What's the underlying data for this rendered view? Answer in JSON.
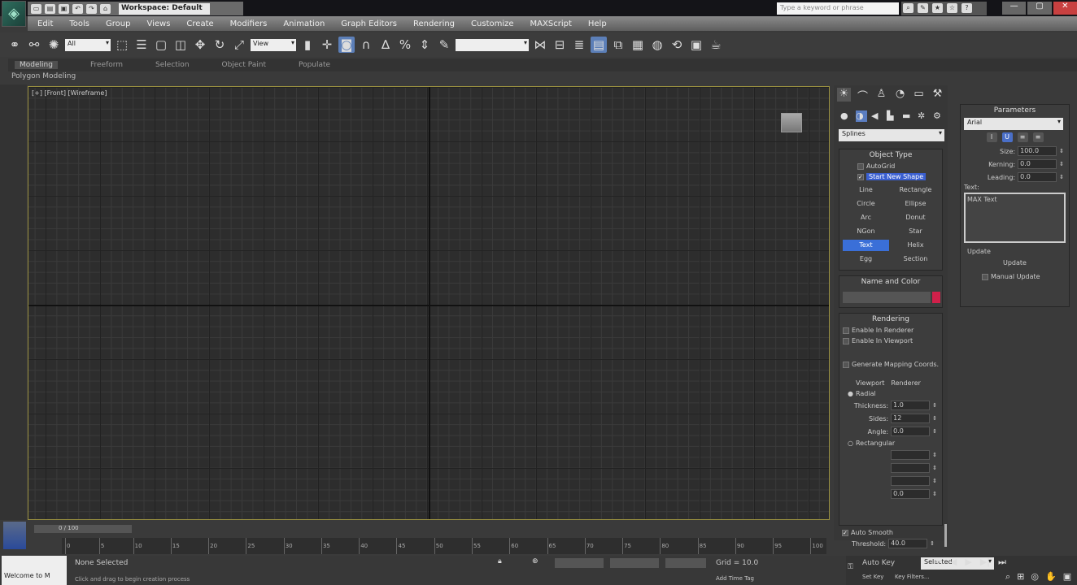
{
  "title_bar": {
    "workspace": "Workspace: Default",
    "search_placeholder": "Type a keyword or phrase",
    "window_buttons": [
      "—",
      "▢",
      "✕"
    ]
  },
  "menu": [
    "Edit",
    "Tools",
    "Group",
    "Views",
    "Create",
    "Modifiers",
    "Animation",
    "Graph Editors",
    "Rendering",
    "Customize",
    "MAXScript",
    "Help"
  ],
  "toolbar": {
    "selection_filter": "All",
    "ref_coord": "View",
    "named_selection": ""
  },
  "ribbon": {
    "tabs": [
      "Modeling",
      "Freeform",
      "Selection",
      "Object Paint",
      "Populate"
    ],
    "active": "Modeling",
    "panel_label": "Polygon Modeling"
  },
  "viewport": {
    "label": "[+] [Front] [Wireframe]"
  },
  "command_panel": {
    "category": "Splines",
    "object_type_title": "Object Type",
    "autogrid": "AutoGrid",
    "start_new_shape": "Start New Shape",
    "buttons": [
      "Line",
      "Rectangle",
      "Circle",
      "Ellipse",
      "Arc",
      "Donut",
      "NGon",
      "Star",
      "Text",
      "Helix",
      "Egg",
      "Section"
    ],
    "active_button": "Text",
    "name_color_title": "Name and Color",
    "object_color": "#d0204a",
    "rendering_title": "Rendering",
    "enable_renderer": "Enable In Renderer",
    "enable_viewport": "Enable In Viewport",
    "gen_mapping": "Generate Mapping Coords.",
    "viewport_opt": "Viewport",
    "renderer_opt": "Renderer",
    "radial": "Radial",
    "thickness_label": "Thickness:",
    "thickness": "1.0",
    "sides_label": "Sides:",
    "sides": "12",
    "angle_label": "Angle:",
    "angle": "0.0",
    "rectangular": "Rectangular",
    "aspect": "0.0",
    "auto_smooth": "Auto Smooth",
    "threshold_label": "Threshold:",
    "threshold": "40.0"
  },
  "parameters": {
    "title": "Parameters",
    "font": "Arial",
    "size_label": "Size:",
    "size": "100.0",
    "kerning_label": "Kerning:",
    "kerning": "0.0",
    "leading_label": "Leading:",
    "leading": "0.0",
    "text_label": "Text:",
    "text": "MAX Text",
    "update_title": "Update",
    "update_btn": "Update",
    "manual_update": "Manual Update"
  },
  "timeline": {
    "frame": "0 / 100",
    "ticks": [
      "0",
      "5",
      "10",
      "15",
      "20",
      "25",
      "30",
      "35",
      "40",
      "45",
      "50",
      "55",
      "60",
      "65",
      "70",
      "75",
      "80",
      "85",
      "90",
      "95",
      "100"
    ]
  },
  "status": {
    "selection": "None Selected",
    "prompt": "Click and drag to begin creation process",
    "grid": "Grid = 10.0",
    "add_time_tag": "Add Time Tag",
    "auto_key": "Auto Key",
    "selected": "Selected",
    "set_key": "Set Key",
    "key_filters": "Key Filters...",
    "maxscript": "Welcome to M"
  }
}
